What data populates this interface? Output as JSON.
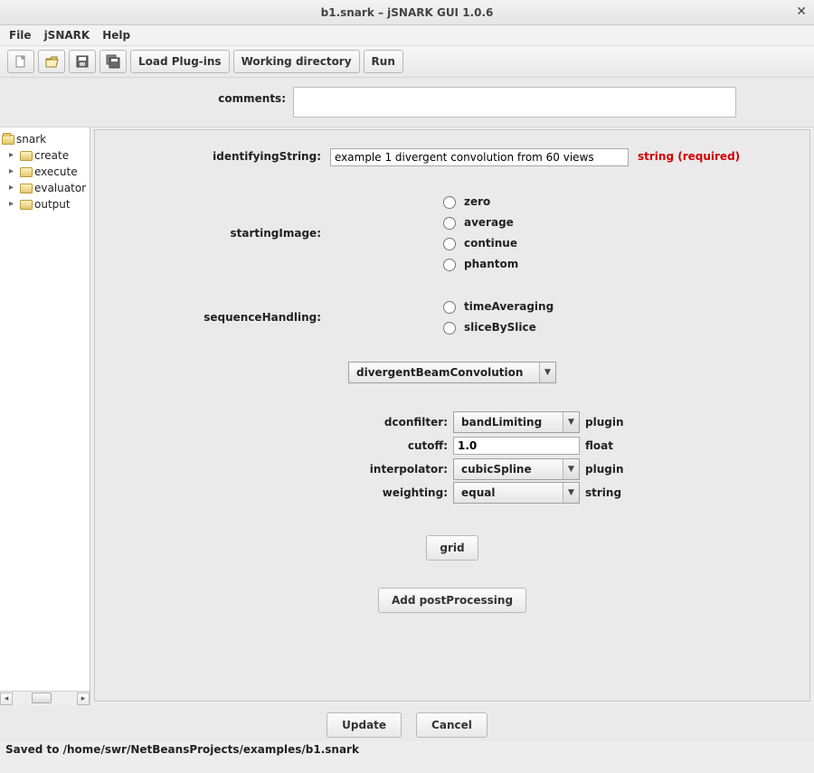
{
  "window": {
    "title": "b1.snark – jSNARK GUI 1.0.6"
  },
  "menubar": {
    "file": "File",
    "jsnark": "jSNARK",
    "help": "Help"
  },
  "toolbar": {
    "load_plugins": "Load Plug-ins",
    "working_directory": "Working directory",
    "run": "Run"
  },
  "comments": {
    "label": "comments:",
    "value": ""
  },
  "tree": {
    "root": "snark",
    "children": [
      "create",
      "execute",
      "evaluator",
      "output"
    ]
  },
  "form": {
    "identifyingString": {
      "label": "identifyingString:",
      "value": "example 1 divergent convolution from 60 views",
      "hint": "string (required)"
    },
    "startingImage": {
      "label": "startingImage:",
      "options": [
        "zero",
        "average",
        "continue",
        "phantom"
      ],
      "selected": ""
    },
    "sequenceHandling": {
      "label": "sequenceHandling:",
      "options": [
        "timeAveraging",
        "sliceBySlice"
      ],
      "selected": ""
    },
    "algorithm": {
      "value": "divergentBeamConvolution"
    },
    "params": {
      "dconfilter": {
        "label": "dconfilter:",
        "value": "bandLimiting",
        "suffix": "plugin"
      },
      "cutoff": {
        "label": "cutoff:",
        "value": "1.0",
        "suffix": "float"
      },
      "interpolator": {
        "label": "interpolator:",
        "value": "cubicSpline",
        "suffix": "plugin"
      },
      "weighting": {
        "label": "weighting:",
        "value": "equal",
        "suffix": "string"
      }
    },
    "grid_button": "grid",
    "add_postprocessing": "Add postProcessing"
  },
  "footer": {
    "update": "Update",
    "cancel": "Cancel"
  },
  "status": "Saved to /home/swr/NetBeansProjects/examples/b1.snark"
}
